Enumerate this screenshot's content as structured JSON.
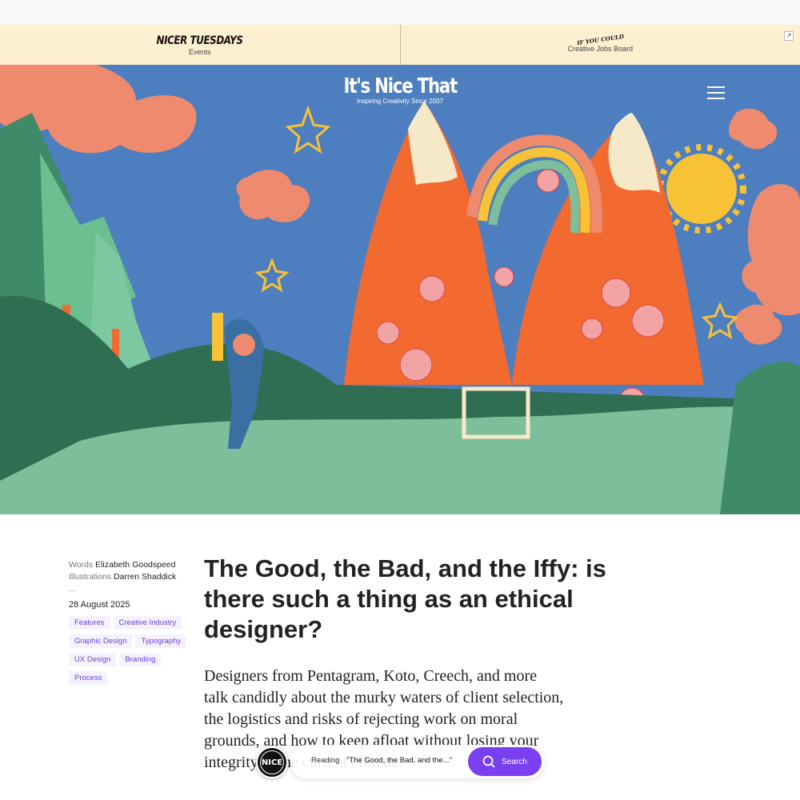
{
  "promo": {
    "left": {
      "title": "NICER TUESDAYS",
      "subtitle": "Events"
    },
    "right": {
      "logo": "IF YOU COULD",
      "subtitle": "Creative Jobs Board"
    },
    "external_icon": "arrow-up-right-icon"
  },
  "header": {
    "brand": "It's Nice That",
    "tagline": "Inspiring Creativity Since 2007",
    "menu_icon": "hamburger-menu-icon"
  },
  "article": {
    "words_label": "Words",
    "words_author": "Elizabeth Goodspeed",
    "illustrations_label": "Illustrations",
    "illustrations_author": "Darren Shaddick",
    "date": "28 August 2025",
    "tags": [
      "Features",
      "Creative Industry",
      "Graphic Design",
      "Typography",
      "UX Design",
      "Branding",
      "Process"
    ],
    "title": "The Good, the Bad, and the Iffy: is there such a thing as an ethical designer?",
    "standfirst": "Designers from Pentagram, Koto, Creech, and more talk candidly about the murky waters of client selection, the logistics and risks of rejecting work on moral grounds, and how to keep afloat without losing your integrity in the current climate."
  },
  "reader_bar": {
    "badge": "NICE",
    "label": "Reading",
    "current": "\"The Good, the Bad, and the...\"",
    "search_label": "Search",
    "search_icon": "search-icon"
  },
  "colors": {
    "accent": "#7b3ff2",
    "promo_bg": "#fdf0d0",
    "tag_bg": "#f5f2fd",
    "tag_text": "#6a3fd8"
  }
}
